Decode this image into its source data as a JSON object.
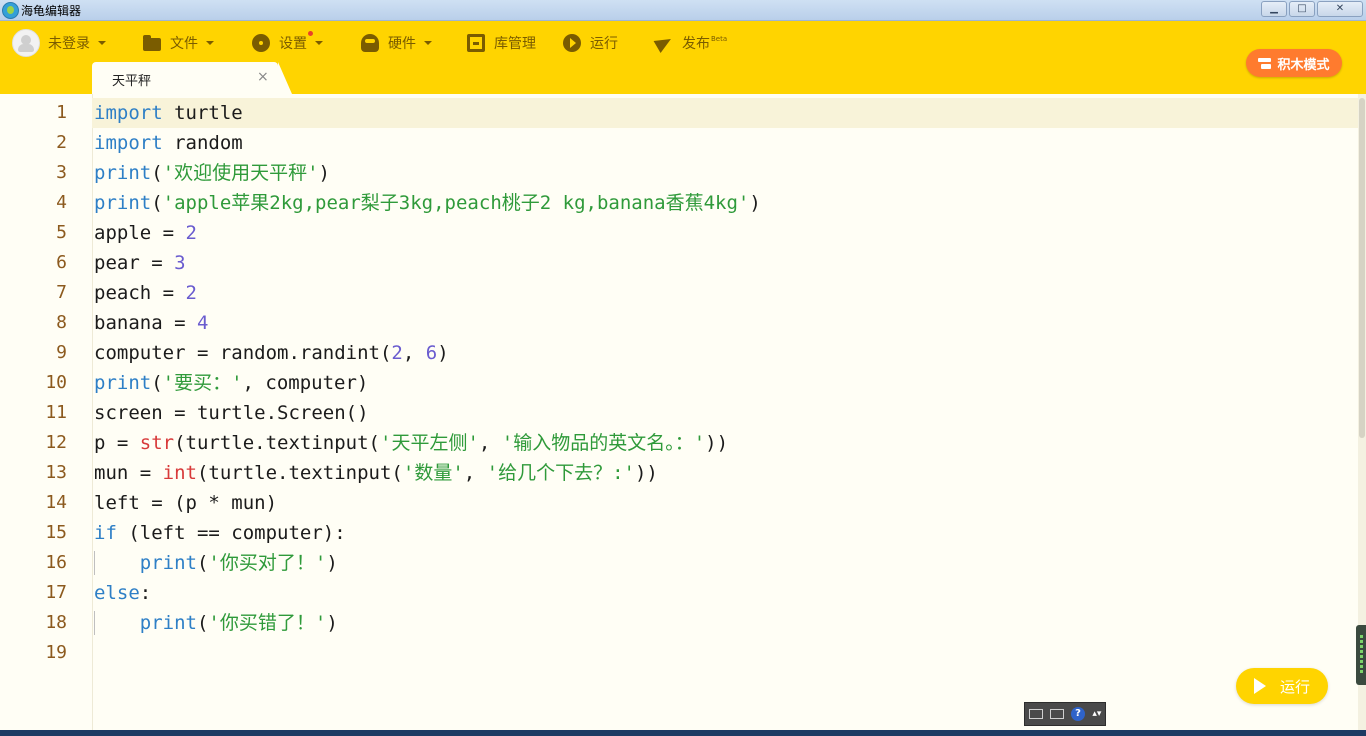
{
  "window": {
    "title": "海龟编辑器",
    "minimize": "▁",
    "maximize": "□",
    "close": "✕"
  },
  "toolbar": {
    "user": "未登录",
    "file": "文件",
    "settings": "设置",
    "hardware": "硬件",
    "library": "库管理",
    "run": "运行",
    "publish": "发布",
    "publish_badge": "Beta",
    "block_mode": "积木模式"
  },
  "tab": {
    "label": "天平秤",
    "close": "×"
  },
  "editor": {
    "line_numbers": [
      "1",
      "2",
      "3",
      "4",
      "5",
      "6",
      "7",
      "8",
      "9",
      "10",
      "11",
      "12",
      "13",
      "14",
      "15",
      "16",
      "17",
      "18",
      "19"
    ],
    "lines": [
      [
        {
          "t": "import",
          "c": "kw"
        },
        {
          "t": " turtle",
          "c": ""
        }
      ],
      [
        {
          "t": "import",
          "c": "kw"
        },
        {
          "t": " random",
          "c": ""
        }
      ],
      [
        {
          "t": "print",
          "c": "kw"
        },
        {
          "t": "(",
          "c": ""
        },
        {
          "t": "'欢迎使用天平秤'",
          "c": "str"
        },
        {
          "t": ")",
          "c": ""
        }
      ],
      [
        {
          "t": "print",
          "c": "kw"
        },
        {
          "t": "(",
          "c": ""
        },
        {
          "t": "'apple苹果2kg,pear梨子3kg,peach桃子2 kg,banana香蕉4kg'",
          "c": "str"
        },
        {
          "t": ")",
          "c": ""
        }
      ],
      [
        {
          "t": "apple = ",
          "c": ""
        },
        {
          "t": "2",
          "c": "num"
        }
      ],
      [
        {
          "t": "pear = ",
          "c": ""
        },
        {
          "t": "3",
          "c": "num"
        }
      ],
      [
        {
          "t": "peach = ",
          "c": ""
        },
        {
          "t": "2",
          "c": "num"
        }
      ],
      [
        {
          "t": "banana = ",
          "c": ""
        },
        {
          "t": "4",
          "c": "num"
        }
      ],
      [
        {
          "t": "computer = random.randint(",
          "c": ""
        },
        {
          "t": "2",
          "c": "num"
        },
        {
          "t": ", ",
          "c": ""
        },
        {
          "t": "6",
          "c": "num"
        },
        {
          "t": ")",
          "c": ""
        }
      ],
      [
        {
          "t": "print",
          "c": "kw"
        },
        {
          "t": "(",
          "c": ""
        },
        {
          "t": "'要买：'",
          "c": "str"
        },
        {
          "t": ", computer)",
          "c": ""
        }
      ],
      [
        {
          "t": "screen = turtle.Screen()",
          "c": ""
        }
      ],
      [
        {
          "t": "p = ",
          "c": ""
        },
        {
          "t": "str",
          "c": "bi"
        },
        {
          "t": "(turtle.textinput(",
          "c": ""
        },
        {
          "t": "'天平左侧'",
          "c": "str"
        },
        {
          "t": ", ",
          "c": ""
        },
        {
          "t": "'输入物品的英文名。：'",
          "c": "str"
        },
        {
          "t": "))",
          "c": ""
        }
      ],
      [
        {
          "t": "mun = ",
          "c": ""
        },
        {
          "t": "int",
          "c": "bi"
        },
        {
          "t": "(turtle.textinput(",
          "c": ""
        },
        {
          "t": "'数量'",
          "c": "str"
        },
        {
          "t": ", ",
          "c": ""
        },
        {
          "t": "'给几个下去？:'",
          "c": "str"
        },
        {
          "t": "))",
          "c": ""
        }
      ],
      [
        {
          "t": "left = (p * mun)",
          "c": ""
        }
      ],
      [
        {
          "t": "if",
          "c": "kw"
        },
        {
          "t": " (left == computer):",
          "c": ""
        }
      ],
      [
        {
          "t": "    ",
          "c": ""
        },
        {
          "t": "print",
          "c": "kw"
        },
        {
          "t": "(",
          "c": ""
        },
        {
          "t": "'你买对了！'",
          "c": "str"
        },
        {
          "t": ")",
          "c": ""
        }
      ],
      [
        {
          "t": "else",
          "c": "kw"
        },
        {
          "t": ":",
          "c": ""
        }
      ],
      [
        {
          "t": "    ",
          "c": ""
        },
        {
          "t": "print",
          "c": "kw"
        },
        {
          "t": "(",
          "c": ""
        },
        {
          "t": "'你买错了！'",
          "c": "str"
        },
        {
          "t": ")",
          "c": ""
        }
      ],
      []
    ]
  },
  "run_button": "运行",
  "ime": {
    "help": "?",
    "arrow": "▴▾"
  },
  "colors": {
    "toolbar_bg": "#ffd400",
    "accent_orange": "#ff7b2e",
    "keyword": "#2e7fc6",
    "string": "#2f9a3a",
    "number": "#6a5ccf",
    "builtin": "#d83a3a",
    "line_number": "#8c5a1e"
  }
}
